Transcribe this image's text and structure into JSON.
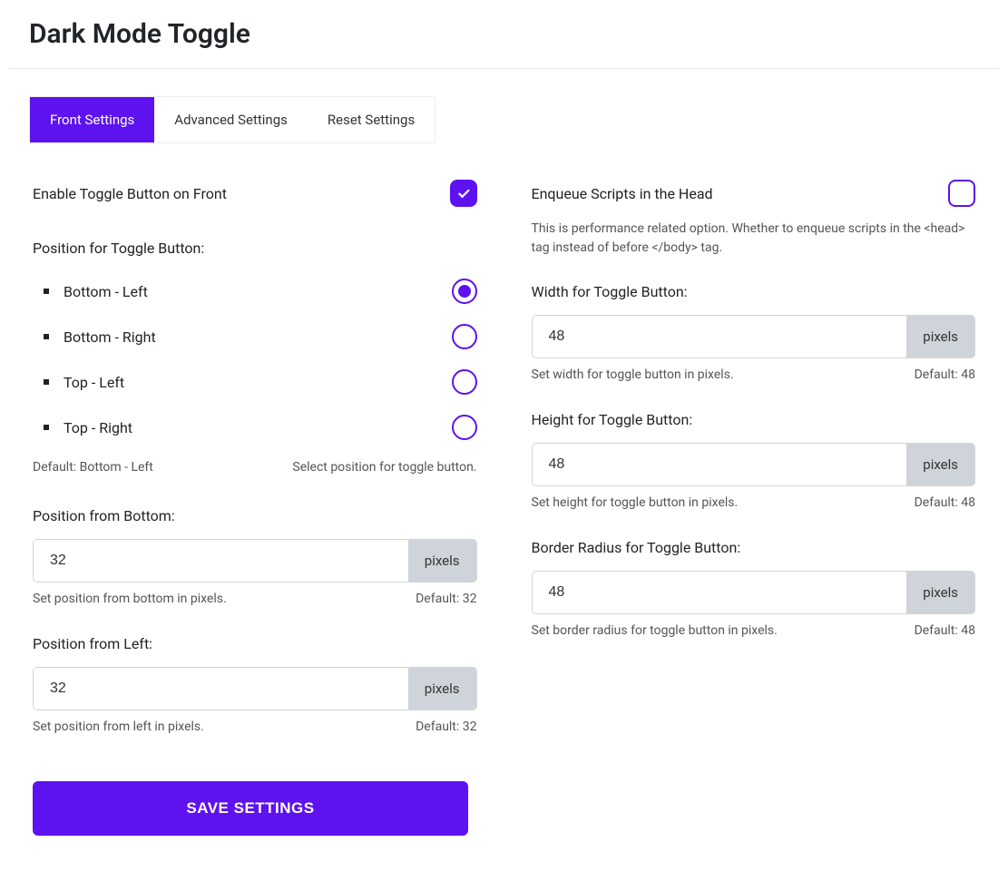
{
  "title": "Dark Mode Toggle",
  "tabs": [
    {
      "label": "Front Settings",
      "active": true
    },
    {
      "label": "Advanced Settings",
      "active": false
    },
    {
      "label": "Reset Settings",
      "active": false
    }
  ],
  "left": {
    "enable_label": "Enable Toggle Button on Front",
    "enable_checked": true,
    "position_label": "Position for Toggle Button:",
    "position_options": [
      {
        "label": "Bottom - Left",
        "selected": true
      },
      {
        "label": "Bottom - Right",
        "selected": false
      },
      {
        "label": "Top - Left",
        "selected": false
      },
      {
        "label": "Top - Right",
        "selected": false
      }
    ],
    "position_default": "Default: Bottom - Left",
    "position_help": "Select position for toggle button.",
    "pos_bottom": {
      "label": "Position from Bottom:",
      "value": "32",
      "unit": "pixels",
      "help": "Set position from bottom in pixels.",
      "default": "Default: 32"
    },
    "pos_left": {
      "label": "Position from Left:",
      "value": "32",
      "unit": "pixels",
      "help": "Set position from left in pixels.",
      "default": "Default: 32"
    },
    "save_label": "SAVE SETTINGS"
  },
  "right": {
    "enqueue_label": "Enqueue Scripts in the Head",
    "enqueue_checked": false,
    "enqueue_desc": "This is performance related option. Whether to enqueue scripts in the <head> tag instead of before </body> tag.",
    "width": {
      "label": "Width for Toggle Button:",
      "value": "48",
      "unit": "pixels",
      "help": "Set width for toggle button in pixels.",
      "default": "Default: 48"
    },
    "height": {
      "label": "Height for Toggle Button:",
      "value": "48",
      "unit": "pixels",
      "help": "Set height for toggle button in pixels.",
      "default": "Default: 48"
    },
    "radius": {
      "label": "Border Radius for Toggle Button:",
      "value": "48",
      "unit": "pixels",
      "help": "Set border radius for toggle button in pixels.",
      "default": "Default: 48"
    }
  }
}
